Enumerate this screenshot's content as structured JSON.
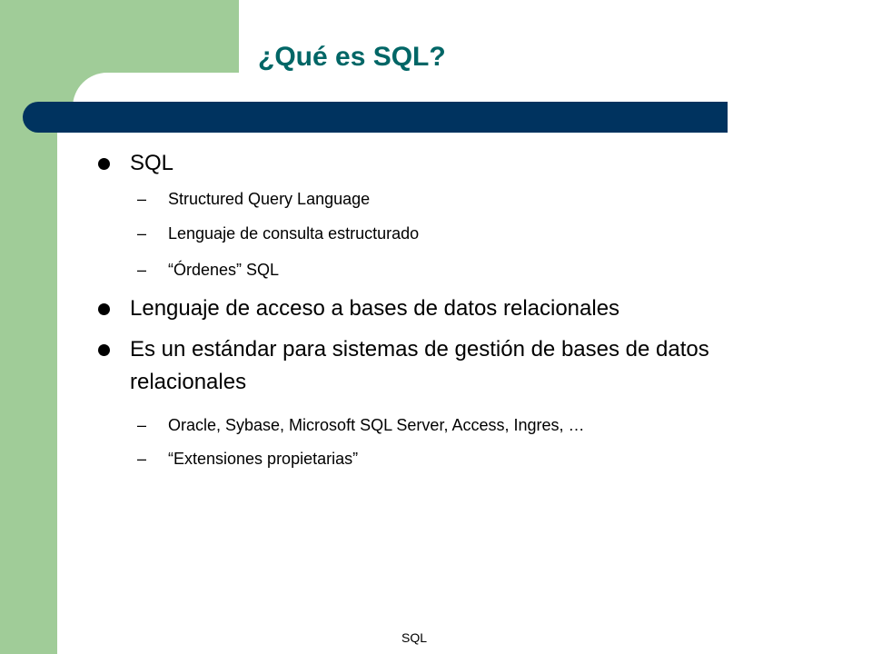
{
  "slide": {
    "title": "¿Qué es SQL?",
    "footer": "SQL",
    "bullets": [
      {
        "text": "SQL",
        "subitems": [
          "Structured Query Language",
          "Lenguaje de consulta estructurado",
          "“Órdenes” SQL"
        ]
      },
      {
        "text": "Lenguaje de acceso a bases de datos relacionales",
        "subitems": []
      },
      {
        "text": "Es un estándar para sistemas de gestión de bases de datos relacionales",
        "subitems": [
          "Oracle, Sybase, Microsoft SQL Server, Access, Ingres, …",
          "“Extensiones propietarias”"
        ]
      }
    ],
    "sub_marker": "–",
    "colors": {
      "title": "#006666",
      "bar": "#00335f",
      "accent_green": "#a0cc98"
    }
  }
}
